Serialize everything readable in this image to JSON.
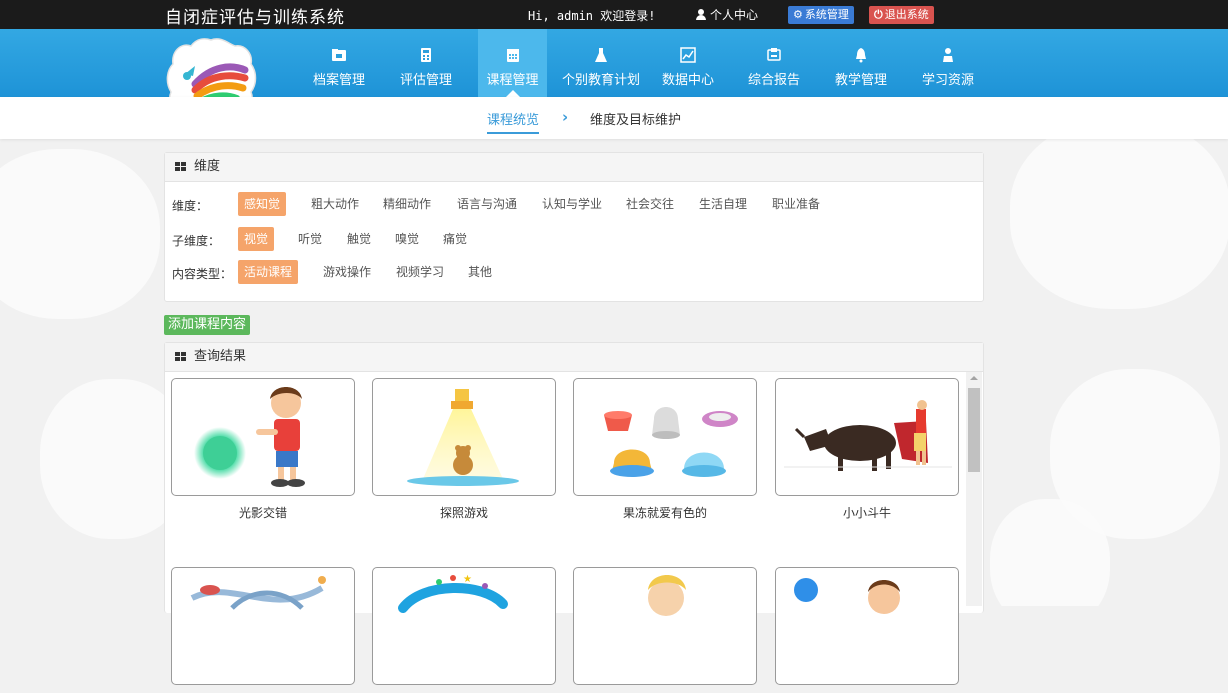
{
  "header": {
    "title": "自闭症评估与训练系统",
    "greeting": "Hi, admin 欢迎登录!",
    "user_center": "个人中心",
    "system_admin": "系统管理",
    "logout": "退出系统"
  },
  "nav": {
    "items": [
      {
        "label": "档案管理",
        "icon": "folder-icon"
      },
      {
        "label": "评估管理",
        "icon": "calculator-icon"
      },
      {
        "label": "课程管理",
        "icon": "calendar-icon"
      },
      {
        "label": "个别教育计划",
        "icon": "flask-icon"
      },
      {
        "label": "数据中心",
        "icon": "chart-icon"
      },
      {
        "label": "综合报告",
        "icon": "report-icon"
      },
      {
        "label": "教学管理",
        "icon": "bell-icon"
      },
      {
        "label": "学习资源",
        "icon": "user-stand-icon"
      }
    ],
    "active": "课程管理"
  },
  "subnav": {
    "items": [
      "课程统览",
      "维度及目标维护"
    ],
    "active": "课程统览",
    "separator": "›"
  },
  "filter_panel": {
    "title": "维度",
    "rows": [
      {
        "label": "维度：",
        "options": [
          "感知觉",
          "粗大动作",
          "精细动作",
          "语言与沟通",
          "认知与学业",
          "社会交往",
          "生活自理",
          "职业准备"
        ],
        "selected": "感知觉"
      },
      {
        "label": "子维度：",
        "options": [
          "视觉",
          "听觉",
          "触觉",
          "嗅觉",
          "痛觉"
        ],
        "selected": "视觉"
      },
      {
        "label": "内容类型：",
        "options": [
          "活动课程",
          "游戏操作",
          "视频学习",
          "其他"
        ],
        "selected": "活动课程"
      }
    ]
  },
  "add_button": "添加课程内容",
  "results": {
    "title": "查询结果",
    "cards": [
      {
        "title": "光影交错"
      },
      {
        "title": "探照游戏"
      },
      {
        "title": "果冻就爱有色的"
      },
      {
        "title": "小小斗牛"
      },
      {
        "title": ""
      },
      {
        "title": ""
      },
      {
        "title": ""
      },
      {
        "title": ""
      }
    ]
  },
  "colors": {
    "nav_blue": "#1e93d7",
    "topbar": "#1b1b1b",
    "selected_tag": "#f5a46a",
    "add_button": "#5cb85c",
    "system_admin": "#3a7bd5",
    "logout": "#d9534f"
  }
}
